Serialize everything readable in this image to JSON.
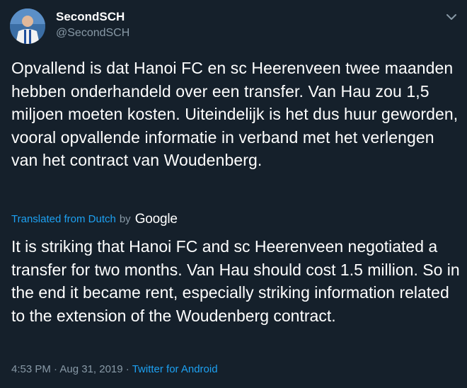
{
  "author": {
    "name": "SecondSCH",
    "handle": "@SecondSCH"
  },
  "tweet": {
    "text": "Opvallend is dat Hanoi FC en sc Heerenveen twee maanden hebben onderhandeld over een transfer. Van Hau zou 1,5 miljoen moeten kosten. Uiteindelijk is het dus huur geworden, vooral opvallende informatie in verband met het verlengen van het contract van Woudenberg.",
    "translation_label": "Translated from Dutch",
    "translation_by": "by",
    "translation_provider": "Google",
    "translation": "It is striking that Hanoi FC and sc Heerenveen negotiated a transfer for two months. Van Hau should cost 1.5 million. So in the end it became rent, especially striking information related to the extension of the Woudenberg contract.",
    "timestamp": "4:53 PM · Aug 31, 2019 ·",
    "source": "Twitter for Android"
  },
  "icons": {
    "menu": "chevron-down-icon"
  },
  "colors": {
    "background": "#15202b",
    "text": "#ffffff",
    "secondary_text": "#8899a6",
    "accent": "#1da1f2"
  }
}
